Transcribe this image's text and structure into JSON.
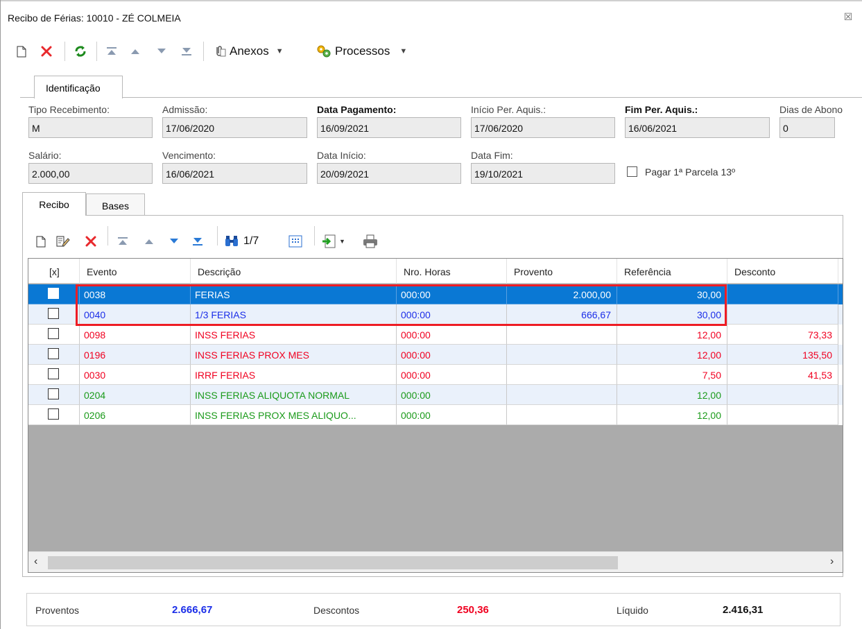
{
  "window": {
    "title": "Recibo de Férias: 10010 - ZÉ COLMEIA",
    "close_glyph": "☒"
  },
  "toolbar": {
    "icons": [
      "new-icon",
      "delete-icon",
      "refresh-icon",
      "first-icon",
      "prev-icon",
      "next-icon",
      "last-icon",
      "attachment-icon",
      "processes-icon"
    ],
    "anexos_label": "Anexos",
    "processos_label": "Processos"
  },
  "tabs": {
    "identificacao": "Identificação"
  },
  "form": {
    "tipo_recebimento_label": "Tipo Recebimento:",
    "tipo_recebimento": "M",
    "admissao_label": "Admissão:",
    "admissao": "17/06/2020",
    "data_pagamento_label": "Data Pagamento:",
    "data_pagamento": "16/09/2021",
    "inicio_per_label": "Início Per. Aquis.:",
    "inicio_per": "17/06/2020",
    "fim_per_label": "Fim Per. Aquis.:",
    "fim_per": "16/06/2021",
    "dias_abono_label": "Dias de Abono",
    "dias_abono": "0",
    "salario_label": "Salário:",
    "salario": "2.000,00",
    "vencimento_label": "Vencimento:",
    "vencimento": "16/06/2021",
    "data_inicio_label": "Data Início:",
    "data_inicio": "20/09/2021",
    "data_fim_label": "Data Fim:",
    "data_fim": "19/10/2021",
    "pagar_13_label": "Pagar 1ª Parcela 13º",
    "pagar_13_checked": false
  },
  "subtabs": {
    "recibo": "Recibo",
    "bases": "Bases"
  },
  "grid_toolbar": {
    "record_position": "1/7"
  },
  "grid": {
    "headers": [
      "[x]",
      "Evento",
      "Descrição",
      "Nro. Horas",
      "Provento",
      "Referência",
      "Desconto"
    ],
    "rows": [
      {
        "evento": "0038",
        "descricao": "FERIAS",
        "horas": "000:00",
        "provento": "2.000,00",
        "referencia": "30,00",
        "desconto": "",
        "color": "blue"
      },
      {
        "evento": "0040",
        "descricao": "1/3 FERIAS",
        "horas": "000:00",
        "provento": "666,67",
        "referencia": "30,00",
        "desconto": "",
        "color": "blue"
      },
      {
        "evento": "0098",
        "descricao": "INSS FERIAS",
        "horas": "000:00",
        "provento": "",
        "referencia": "12,00",
        "desconto": "73,33",
        "color": "red"
      },
      {
        "evento": "0196",
        "descricao": "INSS FERIAS PROX MES",
        "horas": "000:00",
        "provento": "",
        "referencia": "12,00",
        "desconto": "135,50",
        "color": "red"
      },
      {
        "evento": "0030",
        "descricao": "IRRF FERIAS",
        "horas": "000:00",
        "provento": "",
        "referencia": "7,50",
        "desconto": "41,53",
        "color": "red"
      },
      {
        "evento": "0204",
        "descricao": "INSS FERIAS ALIQUOTA NORMAL",
        "horas": "000:00",
        "provento": "",
        "referencia": "12,00",
        "desconto": "",
        "color": "green"
      },
      {
        "evento": "0206",
        "descricao": "INSS FERIAS PROX MES ALIQUO...",
        "horas": "000:00",
        "provento": "",
        "referencia": "12,00",
        "desconto": "",
        "color": "green"
      }
    ],
    "scroll_left": "‹",
    "scroll_right": "›"
  },
  "summary": {
    "proventos_label": "Proventos",
    "proventos": "2.666,67",
    "descontos_label": "Descontos",
    "descontos": "250,36",
    "liquido_label": "Líquido",
    "liquido": "2.416,31"
  },
  "colors": {
    "selection": "#0a78d4",
    "highlight": "#ee1c24",
    "blue": "#1b2ee8",
    "red": "#f00020",
    "green": "#1a9a1a"
  }
}
